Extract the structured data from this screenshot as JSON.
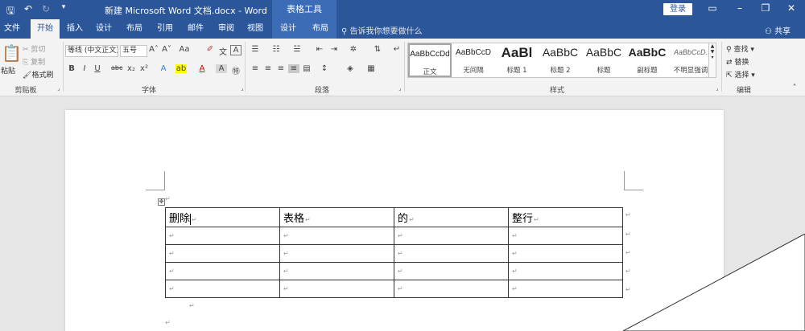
{
  "titlebar": {
    "document_title": "新建 Microsoft Word 文档.docx - Word",
    "context_title": "表格工具",
    "login_label": "登录"
  },
  "tabs": [
    {
      "label": "文件"
    },
    {
      "label": "开始"
    },
    {
      "label": "插入"
    },
    {
      "label": "设计"
    },
    {
      "label": "布局"
    },
    {
      "label": "引用"
    },
    {
      "label": "邮件"
    },
    {
      "label": "审阅"
    },
    {
      "label": "视图"
    },
    {
      "label": "设计"
    },
    {
      "label": "布局"
    }
  ],
  "tell_me": "告诉我你想要做什么",
  "share_label": "共享",
  "clipboard": {
    "paste": "粘贴",
    "cut": "剪切",
    "copy": "复制",
    "format_painter": "格式刷",
    "group_label": "剪贴板"
  },
  "font": {
    "font_name": "等线 (中文正文)",
    "font_size": "五号",
    "group_label": "字体"
  },
  "paragraph": {
    "group_label": "段落"
  },
  "styles": {
    "group_label": "样式",
    "items": [
      {
        "sample": "AaBbCcDd",
        "name": "正文"
      },
      {
        "sample": "AaBbCcD",
        "name": "无间隔"
      },
      {
        "sample": "AaBl",
        "name": "标题 1"
      },
      {
        "sample": "AaBbC",
        "name": "标题 2"
      },
      {
        "sample": "AaBbC",
        "name": "标题"
      },
      {
        "sample": "AaBbC",
        "name": "副标题"
      },
      {
        "sample": "AaBbCcD.",
        "name": "不明显强调"
      }
    ]
  },
  "editing": {
    "find": "查找",
    "replace": "替换",
    "select": "选择",
    "group_label": "编辑"
  },
  "table": {
    "header": [
      "删除",
      "表格",
      "的",
      "整行"
    ]
  },
  "colors": {
    "brand": "#2b579a",
    "ribbon": "#f3f3f3",
    "canvas": "#e6e6e6"
  }
}
